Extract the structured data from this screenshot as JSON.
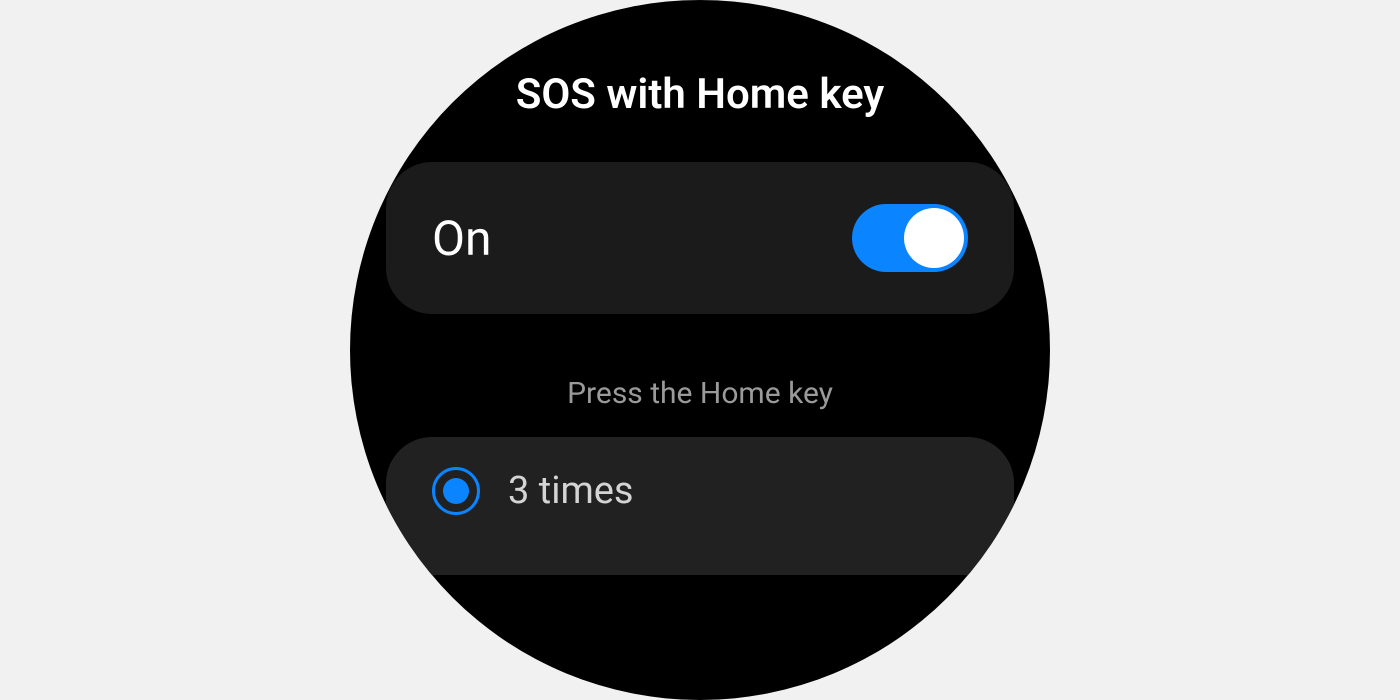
{
  "header": {
    "title": "SOS with Home key"
  },
  "toggle": {
    "label": "On",
    "state": "on"
  },
  "section": {
    "header": "Press the Home key"
  },
  "options": [
    {
      "label": "3 times",
      "selected": true
    }
  ],
  "colors": {
    "accent": "#0a84ff",
    "background": "#000000",
    "card": "#1b1b1b",
    "page": "#f1f1f1"
  }
}
